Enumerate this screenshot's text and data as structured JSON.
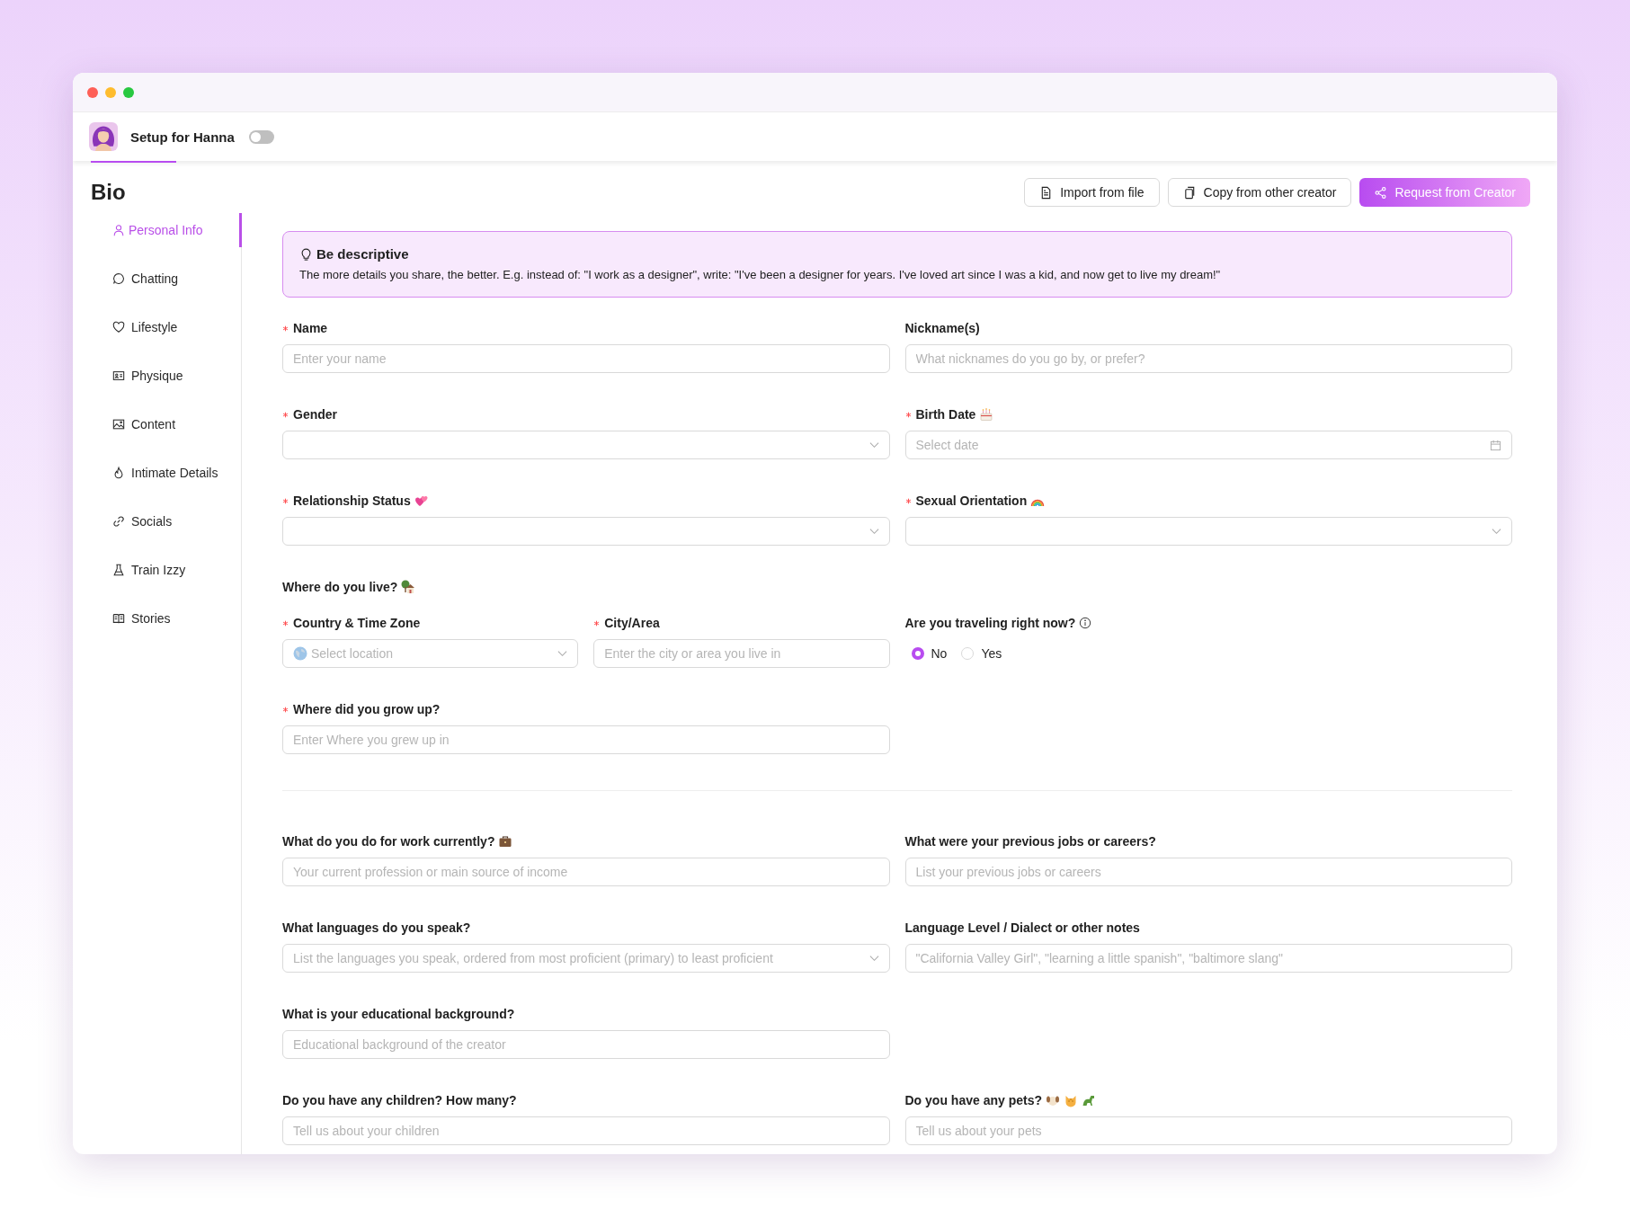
{
  "header": {
    "title": "Setup for Hanna",
    "toggle_on": false
  },
  "page": {
    "title": "Bio"
  },
  "actions": [
    {
      "label": "Import from file",
      "kind": "outline"
    },
    {
      "label": "Copy from other creator",
      "kind": "outline"
    },
    {
      "label": "Request from Creator",
      "kind": "primary"
    }
  ],
  "sidebar": {
    "items": [
      {
        "label": "Personal Info",
        "selected": true
      },
      {
        "label": "Chatting",
        "selected": false
      },
      {
        "label": "Lifestyle",
        "selected": false
      },
      {
        "label": "Physique",
        "selected": false
      },
      {
        "label": "Content",
        "selected": false
      },
      {
        "label": "Intimate Details",
        "selected": false
      },
      {
        "label": "Socials",
        "selected": false
      },
      {
        "label": "Train Izzy",
        "selected": false
      },
      {
        "label": "Stories",
        "selected": false
      }
    ]
  },
  "tip": {
    "title": "Be descriptive",
    "text": "The more details you share, the better. E.g. instead of: \"I work as a designer\", write: \"I've been a designer for years. I've loved art since I was a kid, and now get to live my dream!\""
  },
  "rows": [
    {
      "kind": "halves",
      "fields": [
        {
          "label": "Name",
          "required": true,
          "kind": "text",
          "placeholder": "Enter your name"
        },
        {
          "label": "Nickname(s)",
          "required": false,
          "kind": "text",
          "placeholder": "What nicknames do you go by, or prefer?"
        }
      ]
    },
    {
      "kind": "halves",
      "fields": [
        {
          "label": "Gender",
          "required": true,
          "kind": "select"
        },
        {
          "label": "Birth Date",
          "required": true,
          "kind": "date",
          "placeholder": "Select date"
        }
      ]
    },
    {
      "kind": "halves",
      "fields": [
        {
          "label": "Relationship Status",
          "required": true,
          "kind": "select"
        },
        {
          "label": "Sexual Orientation",
          "required": true,
          "kind": "select"
        }
      ]
    },
    {
      "kind": "heading",
      "text": "Where do you live?"
    },
    {
      "kind": "quarters",
      "fields": [
        {
          "label": "Country & Time Zone",
          "required": true,
          "kind": "location",
          "placeholder": "Select location"
        },
        {
          "label": "City/Area",
          "required": true,
          "kind": "text",
          "placeholder": "Enter the city or area you live in"
        },
        {
          "label": "Are you traveling right now?",
          "required": false,
          "info": true,
          "kind": "radio",
          "options": [
            {
              "label": "No",
              "selected": true
            },
            {
              "label": "Yes",
              "selected": false
            }
          ]
        }
      ]
    },
    {
      "kind": "halves",
      "fields": [
        {
          "label": "Where did you grow up?",
          "required": true,
          "kind": "text",
          "placeholder": "Enter Where you grew up in"
        }
      ]
    },
    {
      "kind": "divider"
    },
    {
      "kind": "halves",
      "fields": [
        {
          "label": "What do you do for work currently?",
          "required": false,
          "kind": "text",
          "placeholder": "Your current profession or main source of income"
        },
        {
          "label": "What were your previous jobs or careers?",
          "required": false,
          "kind": "text",
          "placeholder": "List your previous jobs or careers"
        }
      ]
    },
    {
      "kind": "halves",
      "fields": [
        {
          "label": "What languages do you speak?",
          "required": false,
          "kind": "select",
          "placeholder": "List the languages you speak, ordered from most proficient (primary) to least proficient"
        },
        {
          "label": "Language Level / Dialect or other notes",
          "required": false,
          "kind": "text",
          "placeholder": "\"California Valley Girl\", \"learning a little spanish\", \"baltimore slang\""
        }
      ]
    },
    {
      "kind": "halves",
      "fields": [
        {
          "label": "What is your educational background?",
          "required": false,
          "kind": "text",
          "placeholder": "Educational background of the creator"
        }
      ]
    },
    {
      "kind": "halves",
      "fields": [
        {
          "label": "Do you have any children? How many?",
          "required": false,
          "kind": "text",
          "placeholder": "Tell us about your children"
        },
        {
          "label": "Do you have any pets?",
          "required": false,
          "kind": "text",
          "placeholder": "Tell us about your pets"
        }
      ]
    }
  ]
}
